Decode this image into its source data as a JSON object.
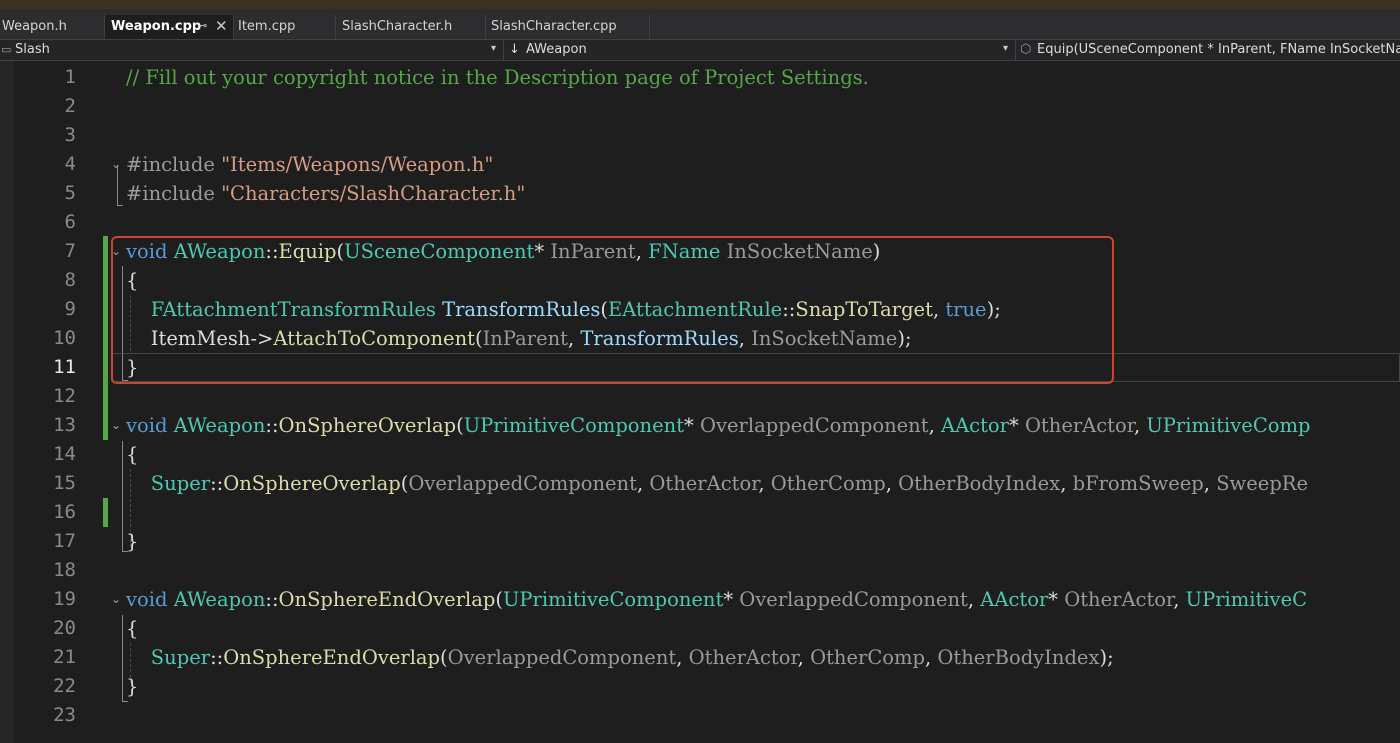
{
  "tabs": [
    {
      "label": "Weapon.h"
    },
    {
      "label": "Weapon.cpp"
    },
    {
      "label": "Item.cpp"
    },
    {
      "label": "SlashCharacter.h"
    },
    {
      "label": "SlashCharacter.cpp"
    }
  ],
  "navbar": {
    "project": "Slash",
    "scope": "AWeapon",
    "member": "Equip(USceneComponent * InParent, FName InSocketName)"
  },
  "lines": [
    {
      "n": "1",
      "tokens": [
        [
          "// Fill out your copyright notice in the Description page of Project Settings.",
          "com"
        ]
      ]
    },
    {
      "n": "2",
      "tokens": []
    },
    {
      "n": "3",
      "tokens": []
    },
    {
      "n": "4",
      "tokens": [
        [
          "#include ",
          "pre"
        ],
        [
          "\"Items/Weapons/Weapon.h\"",
          "str"
        ]
      ]
    },
    {
      "n": "5",
      "tokens": [
        [
          "#include ",
          "pre"
        ],
        [
          "\"Characters/SlashCharacter.h\"",
          "str"
        ]
      ]
    },
    {
      "n": "6",
      "tokens": []
    },
    {
      "n": "7",
      "tokens": [
        [
          "void ",
          "kw"
        ],
        [
          "AWeapon",
          "cls"
        ],
        [
          "::",
          "plain"
        ],
        [
          "Equip",
          "fn"
        ],
        [
          "(",
          "plain"
        ],
        [
          "USceneComponent",
          "cls"
        ],
        [
          "* ",
          "plain"
        ],
        [
          "InParent",
          "par"
        ],
        [
          ", ",
          "plain"
        ],
        [
          "FName ",
          "cls"
        ],
        [
          "InSocketName",
          "par"
        ],
        [
          ")",
          "plain"
        ]
      ]
    },
    {
      "n": "8",
      "tokens": [
        [
          "{",
          "plain"
        ]
      ]
    },
    {
      "n": "9",
      "tokens": [
        [
          "    ",
          "plain"
        ],
        [
          "FAttachmentTransformRules ",
          "cls"
        ],
        [
          "TransformRules",
          "var"
        ],
        [
          "(",
          "plain"
        ],
        [
          "EAttachmentRule",
          "cls"
        ],
        [
          "::",
          "plain"
        ],
        [
          "SnapToTarget",
          "fn"
        ],
        [
          ", ",
          "plain"
        ],
        [
          "true",
          "kw"
        ],
        [
          ");",
          "plain"
        ]
      ]
    },
    {
      "n": "10",
      "tokens": [
        [
          "    ItemMesh->",
          "plain"
        ],
        [
          "AttachToComponent",
          "fn"
        ],
        [
          "(",
          "plain"
        ],
        [
          "InParent",
          "par"
        ],
        [
          ", ",
          "plain"
        ],
        [
          "TransformRules",
          "var"
        ],
        [
          ", ",
          "plain"
        ],
        [
          "InSocketName",
          "par"
        ],
        [
          ");",
          "plain"
        ]
      ]
    },
    {
      "n": "11",
      "tokens": [
        [
          "}",
          "plain"
        ]
      ]
    },
    {
      "n": "12",
      "tokens": []
    },
    {
      "n": "13",
      "tokens": [
        [
          "void ",
          "kw"
        ],
        [
          "AWeapon",
          "cls"
        ],
        [
          "::",
          "plain"
        ],
        [
          "OnSphereOverlap",
          "fn"
        ],
        [
          "(",
          "plain"
        ],
        [
          "UPrimitiveComponent",
          "cls"
        ],
        [
          "* ",
          "plain"
        ],
        [
          "OverlappedComponent",
          "par"
        ],
        [
          ", ",
          "plain"
        ],
        [
          "AActor",
          "cls"
        ],
        [
          "* ",
          "plain"
        ],
        [
          "OtherActor",
          "par"
        ],
        [
          ", ",
          "plain"
        ],
        [
          "UPrimitiveComp",
          "cls"
        ]
      ]
    },
    {
      "n": "14",
      "tokens": [
        [
          "{",
          "plain"
        ]
      ]
    },
    {
      "n": "15",
      "tokens": [
        [
          "    ",
          "plain"
        ],
        [
          "Super",
          "cls"
        ],
        [
          "::",
          "plain"
        ],
        [
          "OnSphereOverlap",
          "fn"
        ],
        [
          "(",
          "plain"
        ],
        [
          "OverlappedComponent",
          "par"
        ],
        [
          ", ",
          "plain"
        ],
        [
          "OtherActor",
          "par"
        ],
        [
          ", ",
          "plain"
        ],
        [
          "OtherComp",
          "par"
        ],
        [
          ", ",
          "plain"
        ],
        [
          "OtherBodyIndex",
          "par"
        ],
        [
          ", ",
          "plain"
        ],
        [
          "bFromSweep",
          "par"
        ],
        [
          ", ",
          "plain"
        ],
        [
          "SweepRe",
          "par"
        ]
      ]
    },
    {
      "n": "16",
      "tokens": []
    },
    {
      "n": "17",
      "tokens": [
        [
          "}",
          "plain"
        ]
      ]
    },
    {
      "n": "18",
      "tokens": []
    },
    {
      "n": "19",
      "tokens": [
        [
          "void ",
          "kw"
        ],
        [
          "AWeapon",
          "cls"
        ],
        [
          "::",
          "plain"
        ],
        [
          "OnSphereEndOverlap",
          "fn"
        ],
        [
          "(",
          "plain"
        ],
        [
          "UPrimitiveComponent",
          "cls"
        ],
        [
          "* ",
          "plain"
        ],
        [
          "OverlappedComponent",
          "par"
        ],
        [
          ", ",
          "plain"
        ],
        [
          "AActor",
          "cls"
        ],
        [
          "* ",
          "plain"
        ],
        [
          "OtherActor",
          "par"
        ],
        [
          ", ",
          "plain"
        ],
        [
          "UPrimitiveC",
          "cls"
        ]
      ]
    },
    {
      "n": "20",
      "tokens": [
        [
          "{",
          "plain"
        ]
      ]
    },
    {
      "n": "21",
      "tokens": [
        [
          "    ",
          "plain"
        ],
        [
          "Super",
          "cls"
        ],
        [
          "::",
          "plain"
        ],
        [
          "OnSphereEndOverlap",
          "fn"
        ],
        [
          "(",
          "plain"
        ],
        [
          "OverlappedComponent",
          "par"
        ],
        [
          ", ",
          "plain"
        ],
        [
          "OtherActor",
          "par"
        ],
        [
          ", ",
          "plain"
        ],
        [
          "OtherComp",
          "par"
        ],
        [
          ", ",
          "plain"
        ],
        [
          "OtherBodyIndex",
          "par"
        ],
        [
          ");",
          "plain"
        ]
      ]
    },
    {
      "n": "22",
      "tokens": [
        [
          "}",
          "plain"
        ]
      ]
    },
    {
      "n": "23",
      "tokens": []
    }
  ],
  "current_line": "11",
  "colors": {
    "background": "#1e1e1e",
    "comment": "#57a64a",
    "keyword": "#569cd6",
    "type": "#4ec9b0",
    "function": "#dcdcaa",
    "string": "#d69d85",
    "highlight_box": "#c9452e",
    "change_bar": "#57a64a"
  }
}
